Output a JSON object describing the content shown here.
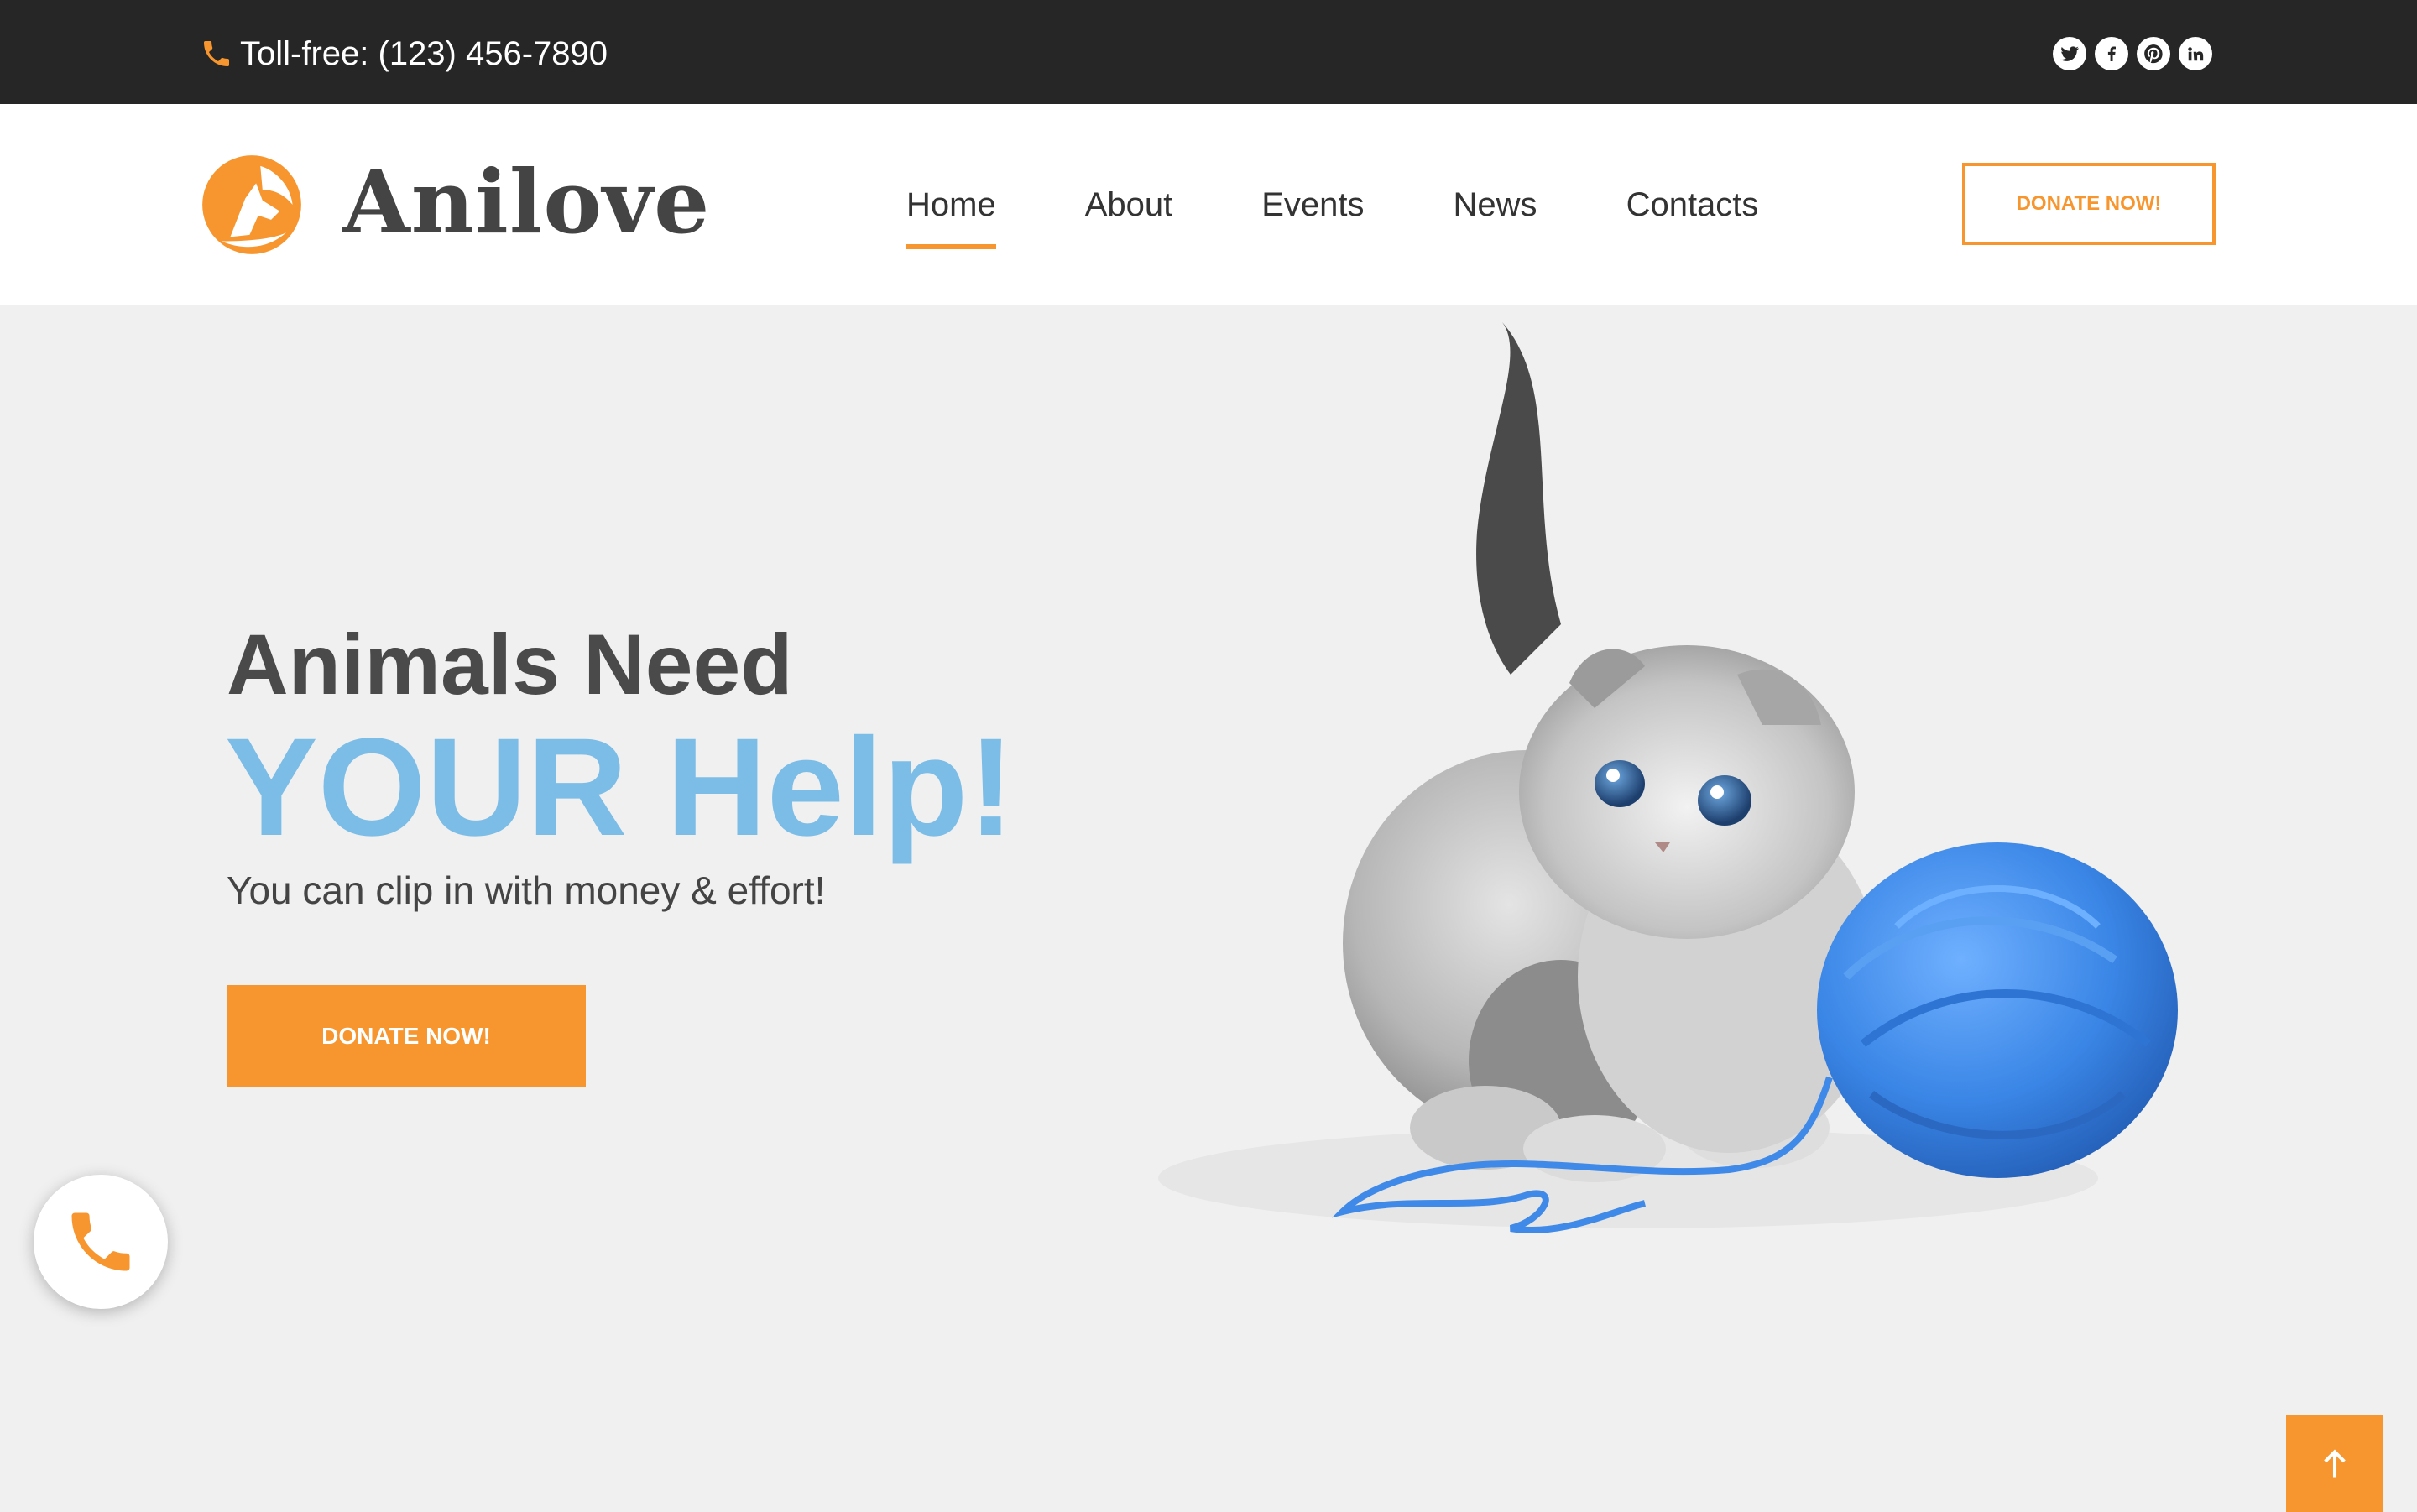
{
  "topbar": {
    "phone_text": "Toll-free: (123) 456-7890",
    "socials": [
      "twitter-icon",
      "facebook-icon",
      "pinterest-icon",
      "linkedin-icon"
    ]
  },
  "header": {
    "logo_text": "Anilove",
    "nav": [
      {
        "label": "Home",
        "active": true
      },
      {
        "label": "About",
        "active": false
      },
      {
        "label": "Events",
        "active": false
      },
      {
        "label": "News",
        "active": false
      },
      {
        "label": "Contacts",
        "active": false
      }
    ],
    "donate_label": "DONATE NOW!"
  },
  "hero": {
    "line1": "Animals Need",
    "line2": "YOUR Help!",
    "subtitle": "You can clip in with money & effort!",
    "donate_label": "DONATE NOW!"
  },
  "colors": {
    "accent": "#f7962e",
    "topbar_bg": "#262626",
    "hero_blue": "#7bbde7",
    "hero_bg": "#f0f0f0"
  }
}
